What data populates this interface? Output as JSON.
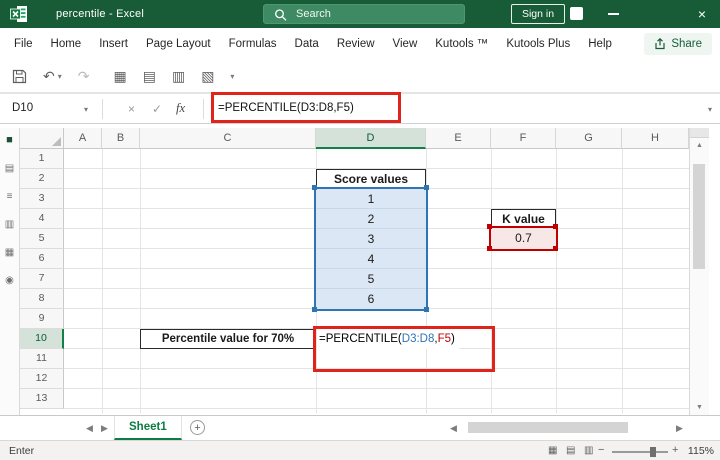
{
  "title_bar": {
    "title": "percentile - Excel",
    "search": "Search",
    "sign_in": "Sign in"
  },
  "menubar": {
    "tabs": [
      "File",
      "Home",
      "Insert",
      "Page Layout",
      "Formulas",
      "Data",
      "Review",
      "View",
      "Kutools ™",
      "Kutools Plus",
      "Help"
    ],
    "share": "Share"
  },
  "formula_bar": {
    "name_box": "D10",
    "fx": "fx",
    "formula": "=PERCENTILE(D3:D8,F5)"
  },
  "grid": {
    "columns": [
      "A",
      "B",
      "C",
      "D",
      "E",
      "F",
      "G",
      "H"
    ],
    "rows": [
      "1",
      "2",
      "3",
      "4",
      "5",
      "6",
      "7",
      "8",
      "9",
      "10",
      "11",
      "12",
      "13"
    ],
    "score_header": "Score values",
    "scores": [
      "1",
      "2",
      "3",
      "4",
      "5",
      "6"
    ],
    "k_header": "K value",
    "k_value": "0.7",
    "row10_label": "Percentile value for 70%",
    "formula": {
      "prefix": "=PERCENTILE(",
      "range": "D3:D8",
      "comma": ",",
      "ref": "F5",
      "suffix": ")"
    }
  },
  "sheet_bar": {
    "active_tab": "Sheet1"
  },
  "status_bar": {
    "mode": "Enter",
    "zoom": "115%"
  },
  "icons": {
    "undo": "↶",
    "redo": "↷",
    "caret": "▾",
    "cancel": "×",
    "check": "✓",
    "close": "×",
    "prev": "◀",
    "next": "▶",
    "up": "▲",
    "down": "▼",
    "plus": "+",
    "minus": "−",
    "qat": [
      "▦",
      "▤",
      "▥",
      "▧"
    ],
    "strip": [
      "■",
      "▤",
      "≡",
      "▥",
      "▦",
      "◉"
    ],
    "views": [
      "▦",
      "▤",
      "▥"
    ]
  },
  "colors": {
    "titlebar_green": "#185C37",
    "accent_green": "#107C41",
    "reference_blue": "#2E75B6",
    "reference_red": "#C00000",
    "annotation_red": "#E0241C",
    "score_fill": "#DBE7F5",
    "k_fill": "#F8E7E7"
  }
}
